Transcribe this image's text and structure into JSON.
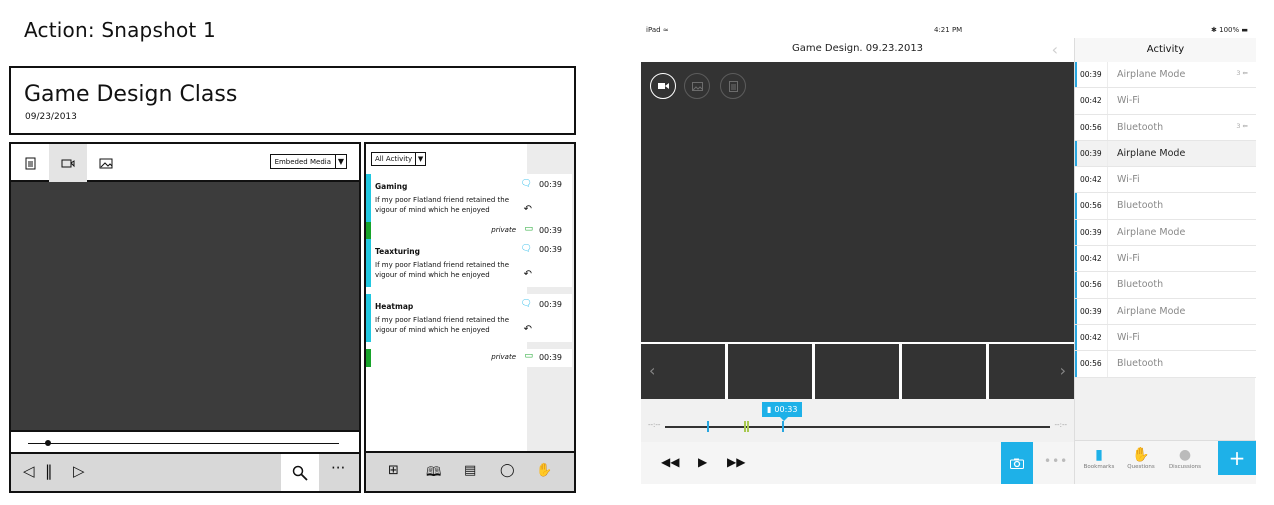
{
  "wireframe": {
    "snapshot_title": "Action: Snapshot 1",
    "class_title": "Game Design Class",
    "date": "09/23/2013",
    "media_select": "Embeded Media",
    "activity_filter": "All Activity",
    "items": [
      {
        "title": "Gaming",
        "body": "If my poor Flatland friend retained the vigour of mind which he enjoyed",
        "time": "00:39",
        "color": "#20c7e0"
      },
      {
        "private": "private",
        "time": "00:39",
        "color": "#17a32a"
      },
      {
        "title": "Teaxturing",
        "body": "If my poor Flatland friend retained the vigour of mind which he enjoyed",
        "time": "00:39",
        "color": "#20c7e0"
      },
      {
        "title": "Heatmap",
        "body": "If my poor Flatland friend retained the vigour of mind which he enjoyed",
        "time": "00:39",
        "color": "#20c7e0"
      },
      {
        "private": "private",
        "time": "00:39",
        "color": "#17a32a"
      }
    ]
  },
  "ipad": {
    "status_left": "iPad ≈",
    "status_time": "4:21 PM",
    "status_right": "✱ 100% ▬",
    "nav_title": "Game Design. 09.23.2013",
    "bookmark_time": "00:33",
    "sidebar_title": "Activity",
    "activity": [
      {
        "time": "00:39",
        "label": "Airplane Mode",
        "count": "3 ⇚",
        "line": true,
        "selected": false
      },
      {
        "time": "00:42",
        "label": "Wi-Fi",
        "count": "",
        "line": false,
        "selected": false
      },
      {
        "time": "00:56",
        "label": "Bluetooth",
        "count": "3 ⇚",
        "line": false,
        "selected": false
      },
      {
        "time": "00:39",
        "label": "Airplane Mode",
        "count": "",
        "line": true,
        "selected": true
      },
      {
        "time": "00:42",
        "label": "Wi-Fi",
        "count": "",
        "line": false,
        "selected": false
      },
      {
        "time": "00:56",
        "label": "Bluetooth",
        "count": "",
        "line": true,
        "selected": false
      },
      {
        "time": "00:39",
        "label": "Airplane Mode",
        "count": "",
        "line": true,
        "selected": false
      },
      {
        "time": "00:42",
        "label": "Wi-Fi",
        "count": "",
        "line": true,
        "selected": false
      },
      {
        "time": "00:56",
        "label": "Bluetooth",
        "count": "",
        "line": true,
        "selected": false
      },
      {
        "time": "00:39",
        "label": "Airplane Mode",
        "count": "",
        "line": true,
        "selected": false
      },
      {
        "time": "00:42",
        "label": "Wi-Fi",
        "count": "",
        "line": true,
        "selected": false
      },
      {
        "time": "00:56",
        "label": "Bluetooth",
        "count": "",
        "line": true,
        "selected": false
      }
    ],
    "tabs": {
      "bookmarks": "Bookmarks",
      "questions": "Questions",
      "discussions": "Discussions"
    },
    "accent_color": "#1eb1e8"
  }
}
